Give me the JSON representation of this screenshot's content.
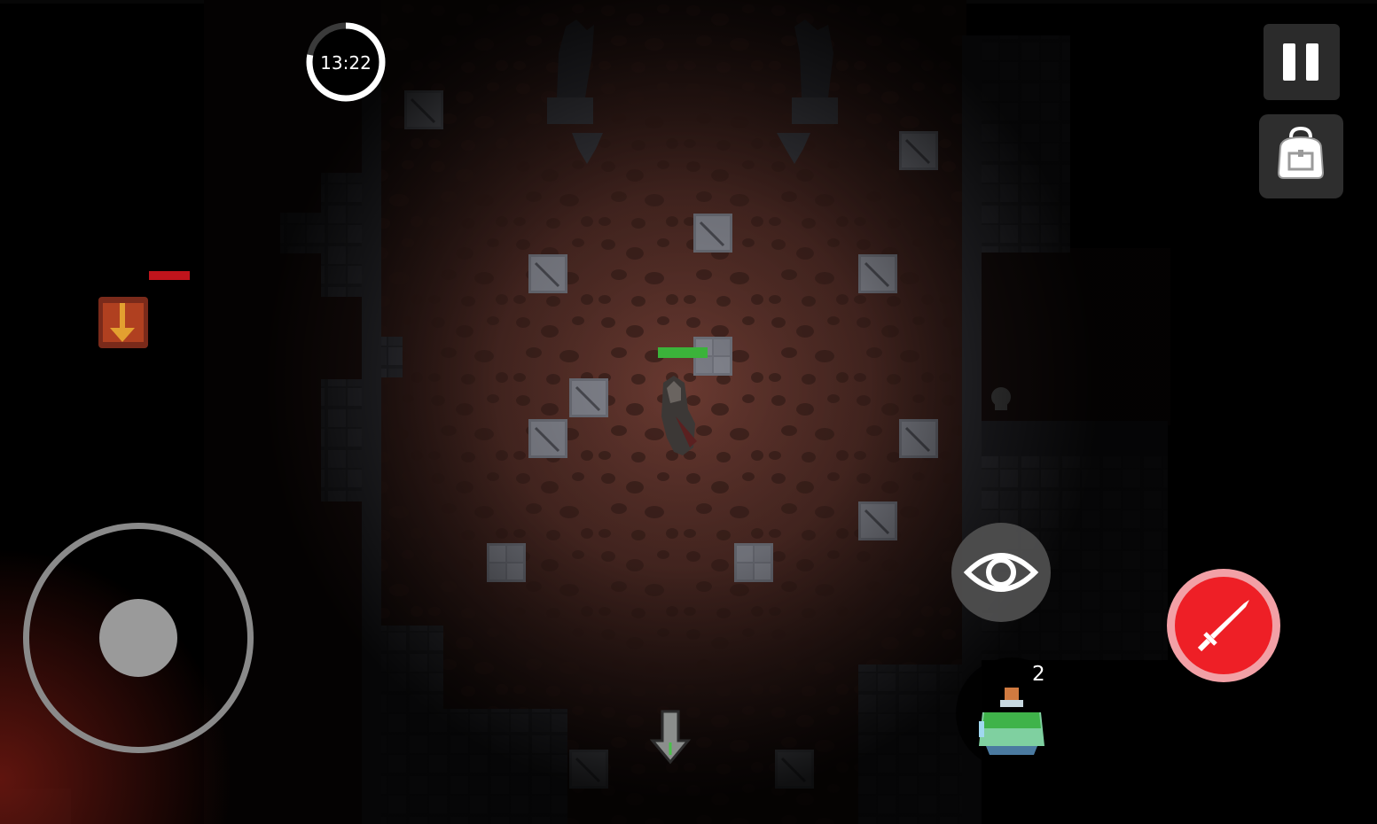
{
  "game": {
    "timer": "13:22",
    "timer_progress": 0.78,
    "player_health": 1.0,
    "enemy_health": 1.0,
    "potion_count": "2"
  },
  "icons": {
    "pause": "pause-icon",
    "backpack": "backpack-icon",
    "look": "eye-icon",
    "attack": "sword-icon",
    "potion": "potion-icon",
    "exit_arrow": "down-arrow-icon"
  },
  "colors": {
    "floor": "#4a2a24",
    "wall": "#3a3a3e",
    "attack_button": "#ee1f26",
    "player_health_bar": "#3bb33a",
    "enemy_health_bar": "#c0141c"
  }
}
